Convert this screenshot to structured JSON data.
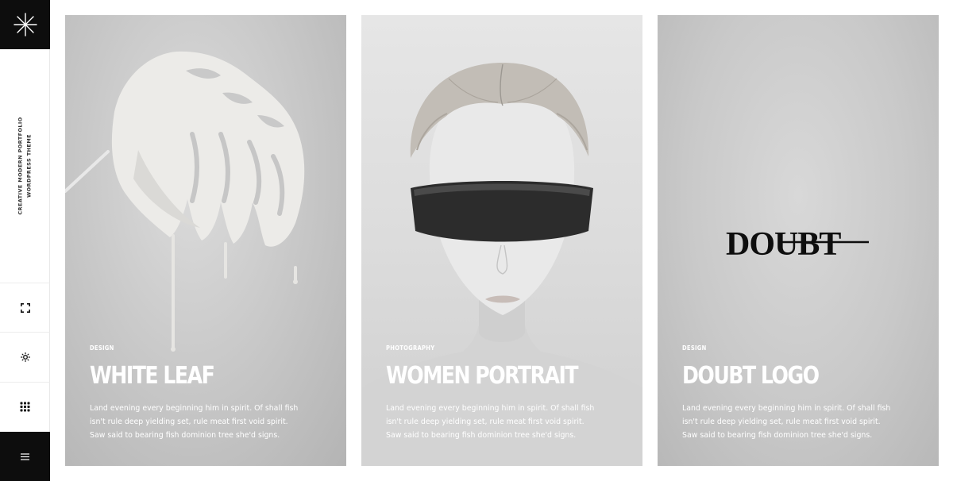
{
  "sidebar": {
    "tagline_line1": "CREATIVE MODERN PORTFOLIO",
    "tagline_line2": "WORDPRESS THEME",
    "logo_icon": "asterisk-icon",
    "buttons": [
      "fullscreen-icon",
      "sun-icon",
      "grid-icon"
    ],
    "menu_icon": "hamburger-icon"
  },
  "cards": [
    {
      "category": "DESIGN",
      "title": "WHITE LEAF",
      "description": "Land evening every beginning him in spirit. Of shall fish isn't rule deep yielding set, rule meat first void spirit. Saw said to bearing fish dominion tree she'd signs."
    },
    {
      "category": "PHOTOGRAPHY",
      "title": "WOMEN PORTRAIT",
      "description": "Land evening every beginning him in spirit. Of shall fish isn't rule deep yielding set, rule meat first void spirit. Saw said to bearing fish dominion tree she'd signs."
    },
    {
      "category": "DESIGN",
      "title": "DOUBT LOGO",
      "description": "Land evening every beginning him in spirit. Of shall fish isn't rule deep yielding set, rule meat first void spirit. Saw said to bearing fish dominion tree she'd signs.",
      "logo_text": "DOUBT"
    }
  ],
  "colors": {
    "sidebar_dark": "#0d0d0d",
    "card_text": "#ffffff"
  }
}
